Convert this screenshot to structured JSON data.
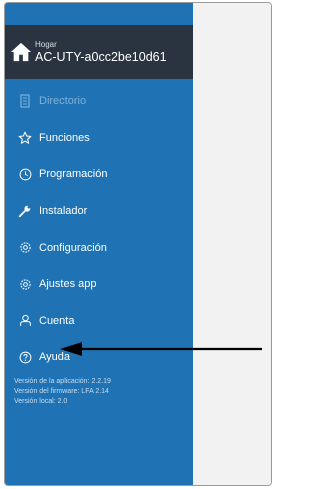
{
  "header": {
    "subtitle": "Hogar",
    "device": "AC-UTY-a0cc2be10d61",
    "icon": "home-icon"
  },
  "menu": [
    {
      "label": "Directorio",
      "icon": "directory-icon",
      "dim": true
    },
    {
      "label": "Funciones",
      "icon": "star-icon",
      "dim": false
    },
    {
      "label": "Programación",
      "icon": "clock-icon",
      "dim": false
    },
    {
      "label": "Instalador",
      "icon": "wrench-icon",
      "dim": false
    },
    {
      "label": "Configuración",
      "icon": "gear-icon",
      "dim": false
    },
    {
      "label": "Ajustes app",
      "icon": "gear-icon",
      "dim": false
    },
    {
      "label": "Cuenta",
      "icon": "person-icon",
      "dim": false
    },
    {
      "label": "Ayuda",
      "icon": "question-circle-icon",
      "dim": false
    }
  ],
  "version": {
    "app": "Versión de la aplicación: 2.2.19",
    "firmware": "Versión del firmware: LFA 2.14",
    "local": "Versión local: 2.0"
  },
  "colors": {
    "sidebar": "#1f73b5",
    "header": "#2a3440",
    "content": "#f2f2f2"
  }
}
